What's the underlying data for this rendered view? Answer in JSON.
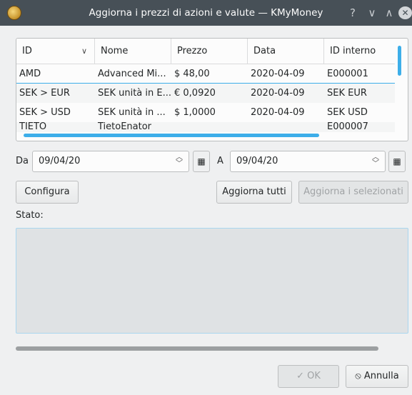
{
  "window": {
    "title": "Aggiorna i prezzi di azioni e valute — KMyMoney",
    "controls": {
      "help": "?",
      "minimize": "∨",
      "maximize": "∧",
      "close": "✕"
    }
  },
  "table": {
    "columns": [
      "ID",
      "Nome",
      "Prezzo",
      "Data",
      "ID interno"
    ],
    "sort_indicator": "∨",
    "rows": [
      {
        "id": "AMD",
        "name": "Advanced Mi...",
        "price": "$ 48,00",
        "date": "2020-04-09",
        "internal_id": "E000001"
      },
      {
        "id": "SEK > EUR",
        "name": "SEK unità in E...",
        "price": "€ 0,0920",
        "date": "2020-04-09",
        "internal_id": "SEK EUR"
      },
      {
        "id": "SEK > USD",
        "name": "SEK unità in ...",
        "price": "$ 1,0000",
        "date": "2020-04-09",
        "internal_id": "SEK USD"
      },
      {
        "id": "TIETO",
        "name": "TietoEnator",
        "price": "",
        "date": "",
        "internal_id": "E000007"
      }
    ]
  },
  "dates": {
    "from_label": "Da",
    "from_value": "09/04/20",
    "to_label": "A",
    "to_value": "09/04/20"
  },
  "buttons": {
    "configure": "Configura",
    "update_all": "Aggiorna tutti",
    "update_selected": "Aggiorna i selezionati",
    "ok": "OK",
    "cancel": "Annulla"
  },
  "status": {
    "label": "Stato:",
    "content": ""
  },
  "colors": {
    "titlebar": "#475057",
    "accent": "#3daee9",
    "window_bg": "#eff0f1"
  }
}
